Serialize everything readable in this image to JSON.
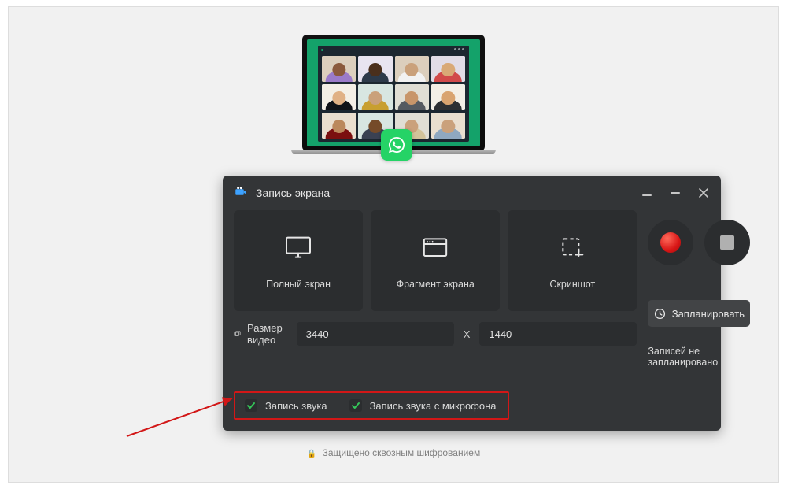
{
  "illustration": {
    "badge": "whatsapp-icon"
  },
  "recorder": {
    "title": "Запись экрана",
    "modes": [
      {
        "id": "fullscreen",
        "label": "Полный экран"
      },
      {
        "id": "fragment",
        "label": "Фрагмент экрана"
      },
      {
        "id": "screenshot",
        "label": "Скриншот"
      }
    ],
    "size": {
      "label": "Размер видео",
      "width": "3440",
      "sep": "X",
      "height": "1440"
    },
    "audio": {
      "system": {
        "label": "Запись звука",
        "checked": true
      },
      "mic": {
        "label": "Запись звука с микрофона",
        "checked": true
      }
    },
    "schedule": {
      "button": "Запланировать",
      "note": "Записей не запланировано"
    }
  },
  "footer": {
    "text": "Защищено сквозным шифрованием"
  }
}
